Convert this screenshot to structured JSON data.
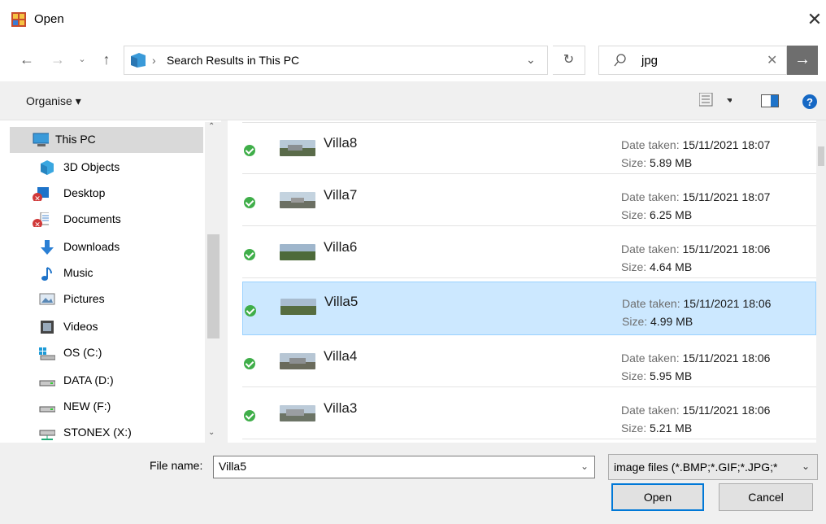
{
  "window": {
    "title": "Open"
  },
  "address": {
    "path_label": "Search Results in This PC"
  },
  "search": {
    "query": "jpg"
  },
  "toolbar": {
    "organise_label": "Organise ▾"
  },
  "nav": {
    "items": [
      {
        "label": "This PC",
        "icon": "computer-icon"
      },
      {
        "label": "3D Objects",
        "icon": "3d-objects-icon"
      },
      {
        "label": "Desktop",
        "icon": "desktop-icon"
      },
      {
        "label": "Documents",
        "icon": "documents-icon"
      },
      {
        "label": "Downloads",
        "icon": "downloads-icon"
      },
      {
        "label": "Music",
        "icon": "music-icon"
      },
      {
        "label": "Pictures",
        "icon": "pictures-icon"
      },
      {
        "label": "Videos",
        "icon": "videos-icon"
      },
      {
        "label": "OS (C:)",
        "icon": "os-drive-icon"
      },
      {
        "label": "DATA (D:)",
        "icon": "drive-icon"
      },
      {
        "label": "NEW (F:)",
        "icon": "drive-icon"
      },
      {
        "label": "STONEX (X:)",
        "icon": "network-drive-icon"
      }
    ]
  },
  "files": {
    "date_label": "Date taken:",
    "size_label": "Size:",
    "items": [
      {
        "name": "Villa8",
        "date": "15/11/2021 18:07",
        "size": "5.89 MB"
      },
      {
        "name": "Villa7",
        "date": "15/11/2021 18:07",
        "size": "6.25 MB"
      },
      {
        "name": "Villa6",
        "date": "15/11/2021 18:06",
        "size": "4.64 MB"
      },
      {
        "name": "Villa5",
        "date": "15/11/2021 18:06",
        "size": "4.99 MB"
      },
      {
        "name": "Villa4",
        "date": "15/11/2021 18:06",
        "size": "5.95 MB"
      },
      {
        "name": "Villa3",
        "date": "15/11/2021 18:06",
        "size": "5.21 MB"
      }
    ]
  },
  "bottom": {
    "filename_label": "File name:",
    "filename_value": "Villa5",
    "filetype": "image files (*.BMP;*.GIF;*.JPG;*",
    "open_label": "Open",
    "cancel_label": "Cancel"
  },
  "colors": {
    "selection": "#cce8ff",
    "accent": "#0078d7",
    "check": "#3fae49"
  }
}
